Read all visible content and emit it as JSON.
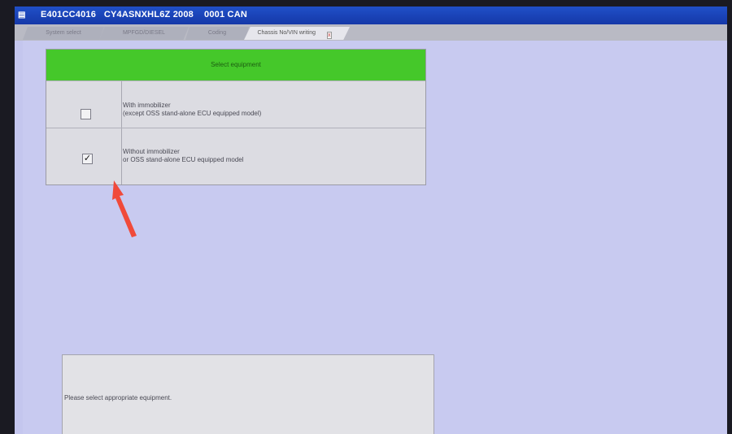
{
  "window": {
    "title": "E401CC4016   CY4ASNXHL6Z 2008    0001 CAN",
    "icon": "app-icon"
  },
  "tabs": [
    {
      "label": "System select",
      "active": false
    },
    {
      "label": "MPFGD/DIESEL",
      "active": false
    },
    {
      "label": "Coding",
      "active": false
    },
    {
      "label": "Chassis No/VIN writing",
      "active": true
    }
  ],
  "tab_close_label": "x",
  "equipment": {
    "header": "Select equipment",
    "options": [
      {
        "line1": "With immobilizer",
        "line2": "(except OSS stand-alone ECU equipped model)",
        "checked": false,
        "check_glyph": ""
      },
      {
        "line1": "Without immobilizer",
        "line2": "or OSS stand-alone ECU equipped model",
        "checked": true,
        "check_glyph": "✓"
      }
    ]
  },
  "message": {
    "text": "Please select appropriate equipment."
  },
  "colors": {
    "header_green": "#45c82a",
    "titlebar_blue": "#1538a8",
    "background": "#c8caf0",
    "annotation_arrow": "#f04a3a"
  }
}
